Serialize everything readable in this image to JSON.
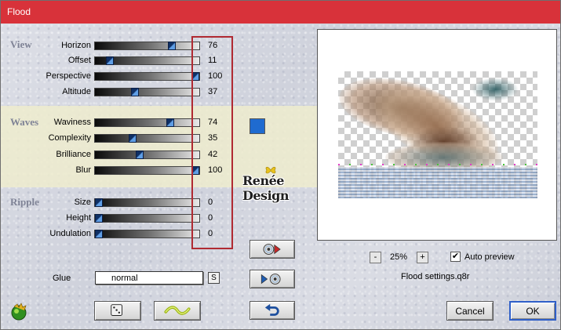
{
  "window": {
    "title": "Flood"
  },
  "sections": {
    "view": {
      "title": "View",
      "rows": [
        {
          "label": "Horizon",
          "value": "76",
          "level": 0.76
        },
        {
          "label": "Offset",
          "value": "11",
          "level": 0.11
        },
        {
          "label": "Perspective",
          "value": "100",
          "level": 1.0
        },
        {
          "label": "Altitude",
          "value": "37",
          "level": 0.37
        }
      ]
    },
    "waves": {
      "title": "Waves",
      "rows": [
        {
          "label": "Waviness",
          "value": "74",
          "level": 0.74
        },
        {
          "label": "Complexity",
          "value": "35",
          "level": 0.35
        },
        {
          "label": "Brilliance",
          "value": "42",
          "level": 0.42
        },
        {
          "label": "Blur",
          "value": "100",
          "level": 1.0
        }
      ],
      "color_swatch": "#1f6bd0"
    },
    "ripple": {
      "title": "Ripple",
      "rows": [
        {
          "label": "Size",
          "value": "0",
          "level": 0
        },
        {
          "label": "Height",
          "value": "0",
          "level": 0
        },
        {
          "label": "Undulation",
          "value": "0",
          "level": 0
        }
      ]
    }
  },
  "watermark": {
    "text": "Renée Design"
  },
  "glue": {
    "label": "Glue",
    "value": "normal",
    "s_button": "S"
  },
  "preview": {
    "zoom_minus": "-",
    "zoom_value": "25%",
    "zoom_plus": "+",
    "auto_preview_label": "Auto preview",
    "auto_preview_checked": true,
    "settings_file": "Flood settings.q8r"
  },
  "buttons": {
    "cancel": "Cancel",
    "ok": "OK"
  },
  "icons": {
    "save_preset": "disc-arrow-right-icon",
    "load_preset": "arrow-disc-icon",
    "randomize": "dice-icon",
    "wave_preset": "wave-icon",
    "reset": "undo-arrow-icon",
    "logo": "filters-unlimited-logo-icon"
  },
  "colors": {
    "title_bar": "#d8323a",
    "highlight_frame": "#b02a32",
    "waves_band": "#eeecce"
  }
}
